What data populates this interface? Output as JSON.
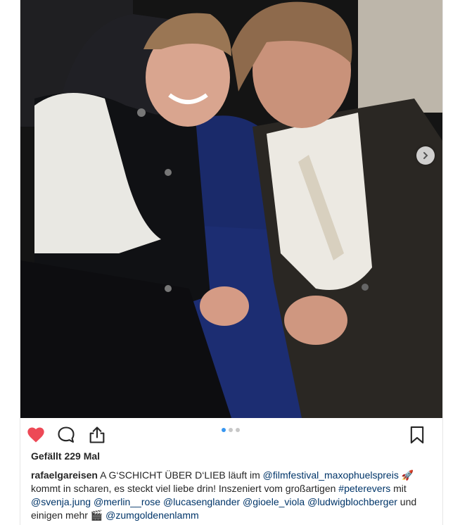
{
  "post": {
    "likes_text": "Gefällt 229 Mal",
    "username": "rafaelgareisen",
    "caption_parts": [
      {
        "t": "text",
        "v": " A G‘SCHICHT ÜBER D‘LIEB läuft im "
      },
      {
        "t": "link",
        "v": "@filmfestival_maxophuelspreis"
      },
      {
        "t": "text",
        "v": " 🚀 kommt in scharen, es steckt viel liebe drin! Inszeniert vom großartigen "
      },
      {
        "t": "link",
        "v": "#peterevers"
      },
      {
        "t": "text",
        "v": " mit "
      },
      {
        "t": "link",
        "v": "@svenja.jung"
      },
      {
        "t": "text",
        "v": " "
      },
      {
        "t": "link",
        "v": "@merlin__rose"
      },
      {
        "t": "text",
        "v": " "
      },
      {
        "t": "link",
        "v": "@lucasenglander"
      },
      {
        "t": "text",
        "v": " "
      },
      {
        "t": "link",
        "v": "@gioele_viola"
      },
      {
        "t": "text",
        "v": " "
      },
      {
        "t": "link",
        "v": "@ludwigblochberger"
      },
      {
        "t": "text",
        "v": " und einigen mehr 🎬 "
      },
      {
        "t": "link",
        "v": "@zumgoldenenlamm"
      }
    ],
    "carousel": {
      "count": 3,
      "active": 0
    },
    "colors": {
      "heart": "#ed4956",
      "link": "#003569",
      "dot_active": "#3897f0"
    }
  },
  "icons": {
    "like": "heart-filled-icon",
    "comment": "comment-bubble-icon",
    "share": "share-upload-icon",
    "save": "bookmark-icon",
    "next": "chevron-right-icon"
  }
}
